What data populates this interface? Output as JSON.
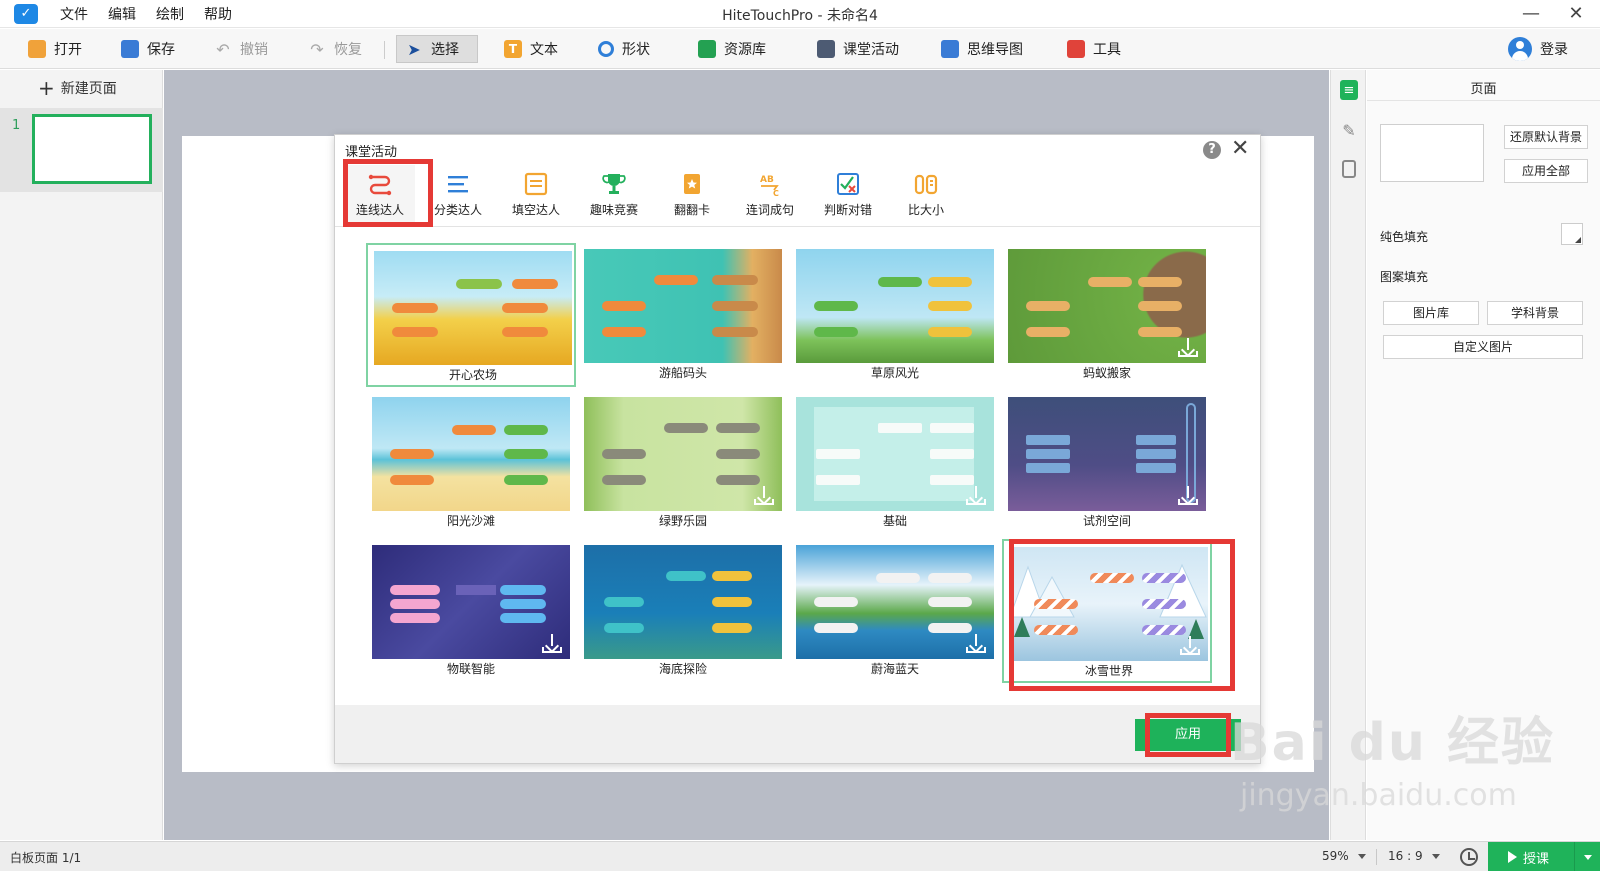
{
  "titlebar": {
    "title": "HiteTouchPro - 未命名4",
    "menu": [
      "文件",
      "编辑",
      "绘制",
      "帮助"
    ]
  },
  "toolbar": {
    "open": "打开",
    "save": "保存",
    "undo": "撤销",
    "redo": "恢复",
    "select": "选择",
    "text": "文本",
    "shape": "形状",
    "resources": "资源库",
    "activity": "课堂活动",
    "mindmap": "思维导图",
    "tools": "工具",
    "login": "登录"
  },
  "left_panel": {
    "new_page": "新建页面",
    "page_number": "1"
  },
  "props": {
    "title": "页面",
    "restore_bg": "还原默认背景",
    "apply_all": "应用全部",
    "solid_fill": "纯色填充",
    "pattern_fill": "图案填充",
    "gallery": "图片库",
    "subject_bg": "学科背景",
    "custom_image": "自定义图片"
  },
  "status": {
    "page_info": "白板页面 1/1",
    "zoom": "59%",
    "ratio": "16 : 9",
    "lecture": "授课"
  },
  "dialog": {
    "title": "课堂活动",
    "tabs": [
      "连线达人",
      "分类达人",
      "填空达人",
      "趣味竞赛",
      "翻翻卡",
      "连词成句",
      "判断对错",
      "比大小"
    ],
    "active_tab": "连线达人",
    "templates": [
      {
        "name": "开心农场",
        "bg": "#f6c445"
      },
      {
        "name": "游船码头",
        "bg": "#46c7b6"
      },
      {
        "name": "草原风光",
        "bg": "#7cc9e4"
      },
      {
        "name": "蚂蚁搬家",
        "bg": "#7ab046"
      },
      {
        "name": "阳光沙滩",
        "bg": "#8fd3ea"
      },
      {
        "name": "绿野乐园",
        "bg": "#9bc96a"
      },
      {
        "name": "基础",
        "bg": "#a8e3dc"
      },
      {
        "name": "试剂空间",
        "bg": "#4f4d86"
      },
      {
        "name": "物联智能",
        "bg": "#3c3a8c"
      },
      {
        "name": "海底探险",
        "bg": "#1a7fb8"
      },
      {
        "name": "蔚海蓝天",
        "bg": "#4aa3d8"
      },
      {
        "name": "冰雪世界",
        "bg": "#d7ebf6"
      }
    ],
    "selected_template": "冰雪世界",
    "apply": "应用"
  },
  "watermark": {
    "brand": "Bai du 经验",
    "url": "jingyan.baidu.com"
  }
}
